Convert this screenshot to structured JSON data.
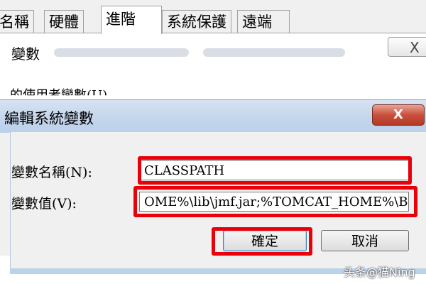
{
  "parent_window": {
    "tabs": [
      {
        "label": "名稱"
      },
      {
        "label": "硬體"
      },
      {
        "label": "進階"
      },
      {
        "label": "系統保護"
      },
      {
        "label": "遠端"
      }
    ],
    "active_tab": "進階",
    "section_title": "變數",
    "user_vars_label": "的使用者變數(U)",
    "close_glyph": "X"
  },
  "dialog": {
    "title": "編輯系統變數",
    "close_glyph": "X",
    "name_label": "變數名稱(N):",
    "name_value": "CLASSPATH",
    "value_label": "變數值(V):",
    "value_value": "OME%\\lib\\jmf.jar;%TOMCAT_HOME%\\BIN",
    "ok_label": "確定",
    "cancel_label": "取消"
  },
  "watermark": "头条@猫Ning",
  "colors": {
    "highlight_red": "#e8000a",
    "title_bar_blue": "#c3d5ec",
    "close_red": "#c9503c"
  }
}
